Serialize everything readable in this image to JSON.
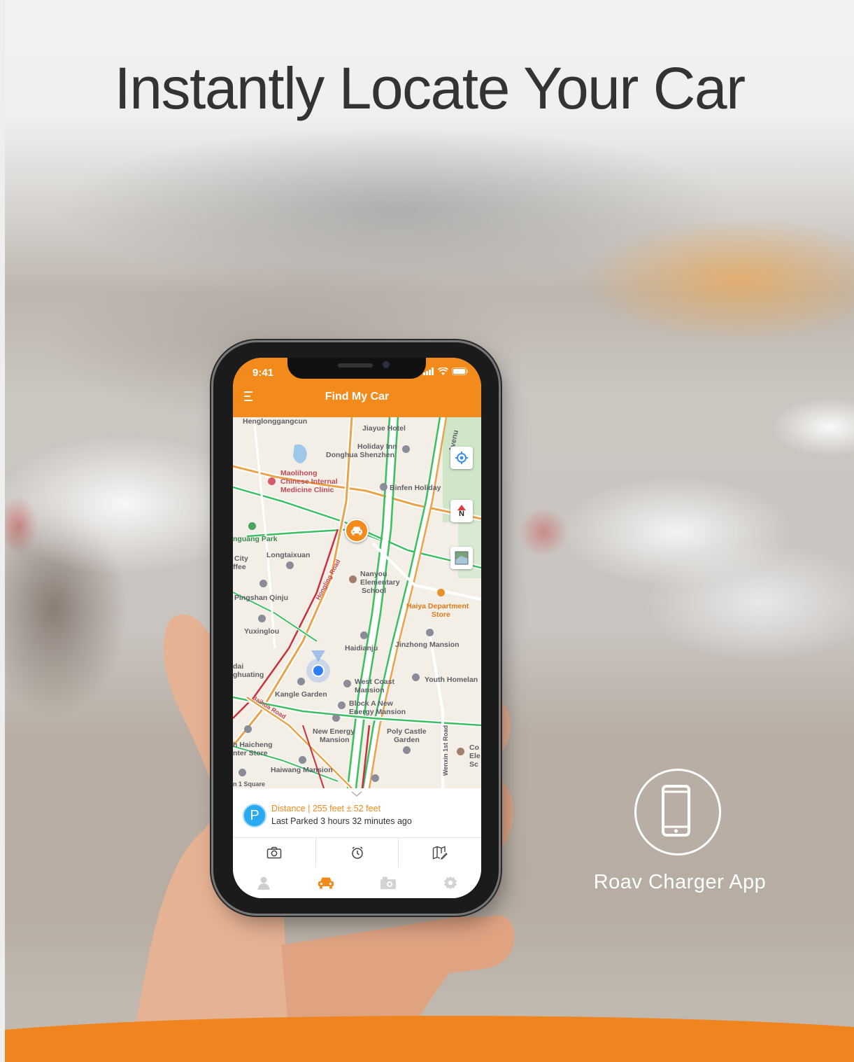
{
  "headline": "Instantly Locate Your Car",
  "phone": {
    "status_time": "9:41",
    "app_title": "Find My Car",
    "map": {
      "labels": {
        "henglong": "Henglonggangcun",
        "jiayue": "Jiayue Hotel",
        "holiday_inn": "Holiday Inn",
        "donghua": "Donghua Shenzhen",
        "avenue": "Avenu",
        "maolihong_1": "Maolihong",
        "maolihong_2": "Chinese Internal",
        "maolihong_3": "Medicine Clinic",
        "binfen": "Binfen Holiday",
        "park": "nguang Park",
        "city_1": "City",
        "city_2": "ffee",
        "longtaixuan": "Longtaixuan",
        "nanyou_1": "Nanyou",
        "nanyou_2": "Elementary",
        "nanyou_3": "School",
        "pingshan": "Pingshan Qinju",
        "haiya_1": "Haiya Department",
        "haiya_2": "Store",
        "yuxinglou": "Yuxinglou",
        "haidianju": "Haidianju",
        "jinzhong": "Jinzhong Mansion",
        "dai_1": "dai",
        "dai_2": "ghuating",
        "west_coast_1": "West Coast",
        "west_coast_2": "Mansion",
        "youth": "Youth Homelan",
        "kangle": "Kangle Garden",
        "block_1": "Block A New",
        "block_2": "Energy Mansion",
        "new_energy_1": "New Energy",
        "new_energy_2": "Mansion",
        "poly_1": "Poly Castle",
        "poly_2": "Garden",
        "haicheng_1": "h Haicheng",
        "haicheng_2": "nter Store",
        "haiwang": "Haiwang Mansion",
        "wenxin": "Wenxin 1st Road",
        "co_1": "Co",
        "co_2": "Ele",
        "co_3": "Sc",
        "square": "n 1 Square",
        "baihua": "Baihua Road",
        "huaqiang": "Hongling Road"
      },
      "compass_label": "N"
    },
    "distance_text": "Distance | 255 feet ± 52 feet",
    "last_parked_text": "Last Parked 3 hours 32 minutes ago",
    "parking_badge": "P",
    "actions": [
      "camera-icon",
      "alarm-clock-icon",
      "map-edit-icon"
    ],
    "tabs": [
      {
        "icon": "person-icon",
        "active": false
      },
      {
        "icon": "car-icon",
        "active": true
      },
      {
        "icon": "dashcam-icon",
        "active": false
      },
      {
        "icon": "gear-icon",
        "active": false
      }
    ]
  },
  "app_caption": "Roav Charger App",
  "colors": {
    "accent": "#f28a1c",
    "headline": "#333333",
    "parking_badge": "#29a9f0",
    "inactive_icon": "#c8c8c8"
  }
}
